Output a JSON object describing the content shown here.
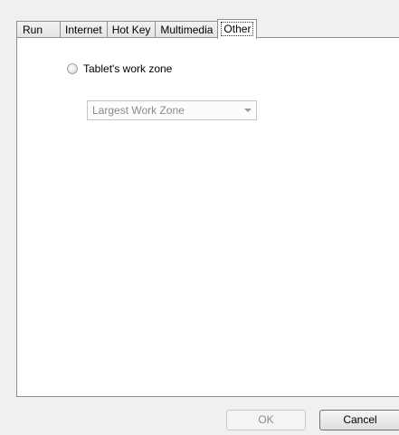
{
  "tabs": [
    {
      "label": "Run"
    },
    {
      "label": "Internet"
    },
    {
      "label": "Hot Key"
    },
    {
      "label": "Multimedia"
    },
    {
      "label": "Other"
    }
  ],
  "active_tab": "Other",
  "other": {
    "radio_label": "Tablet's work zone",
    "radio_checked": false,
    "zone_select": {
      "value": "Largest Work Zone",
      "disabled": true
    }
  },
  "buttons": {
    "ok": "OK",
    "cancel": "Cancel"
  },
  "colors": {
    "panel_bg": "#ffffff",
    "dialog_bg": "#f0f0f0",
    "disabled_text": "#8a8a8a"
  }
}
